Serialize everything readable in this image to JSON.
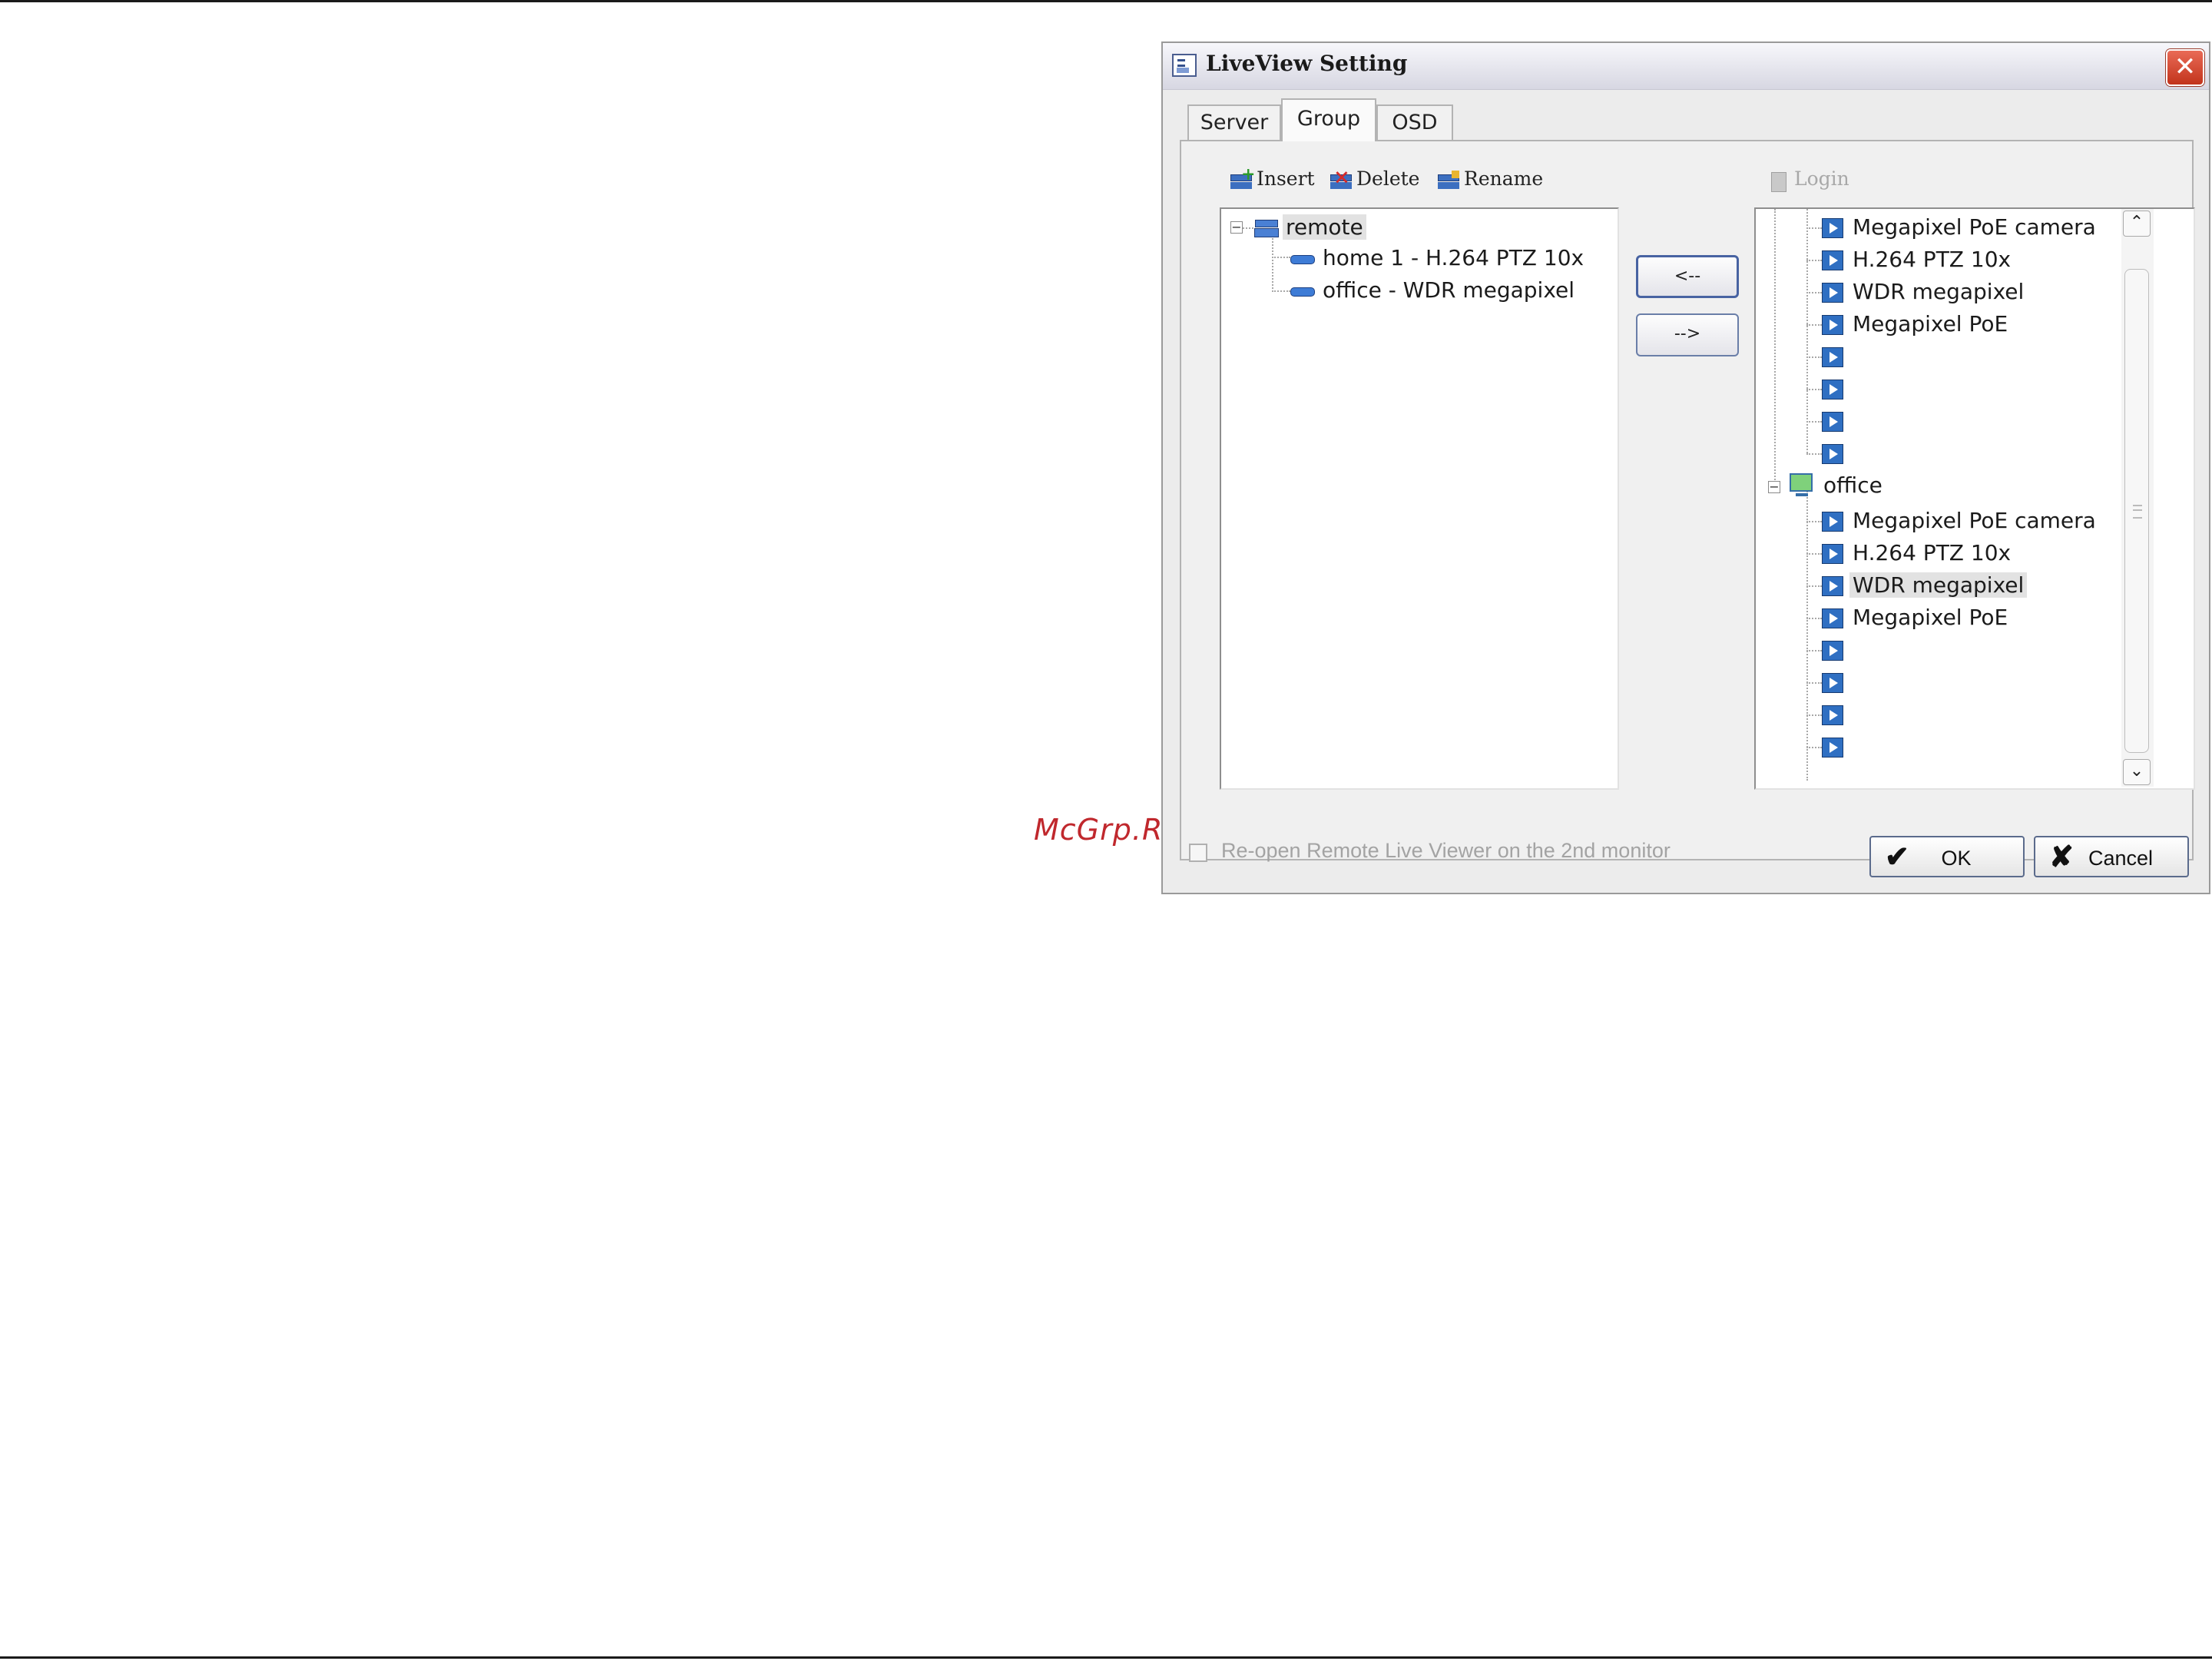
{
  "watermark": "McGrp.Ru",
  "dialog": {
    "title": "LiveView Setting",
    "close_glyph": "✕",
    "tabs": [
      {
        "label": "Server"
      },
      {
        "label": "Group"
      },
      {
        "label": "OSD"
      }
    ],
    "active_tab": "Group"
  },
  "toolbar": {
    "insert": "Insert",
    "delete": "Delete",
    "rename": "Rename",
    "login": "Login"
  },
  "group_tree": {
    "root": {
      "label": "remote",
      "icon": "group-icon"
    },
    "items": [
      {
        "label": "home 1 - H.264 PTZ 10x",
        "icon": "camera-icon"
      },
      {
        "label": "office - WDR megapixel",
        "icon": "camera-icon"
      }
    ]
  },
  "transfer": {
    "add_label": "<--",
    "remove_label": "-->"
  },
  "server_tree": {
    "first_group_channels": [
      "Megapixel PoE camera",
      "H.264 PTZ 10x",
      "WDR megapixel",
      "Megapixel PoE",
      "",
      "",
      "",
      ""
    ],
    "office": {
      "label": "office",
      "channels": [
        "Megapixel PoE camera",
        "H.264 PTZ 10x",
        "WDR megapixel",
        "Megapixel PoE",
        "",
        "",
        "",
        ""
      ],
      "selected": "WDR megapixel"
    }
  },
  "scrollbar": {
    "up": "⌃",
    "down": "⌄"
  },
  "footer": {
    "reopen_label": "Re-open Remote Live Viewer on the 2nd monitor",
    "reopen_checked": false,
    "ok_label": "OK",
    "ok_glyph": "✔",
    "cancel_label": "Cancel",
    "cancel_glyph": "✘"
  }
}
